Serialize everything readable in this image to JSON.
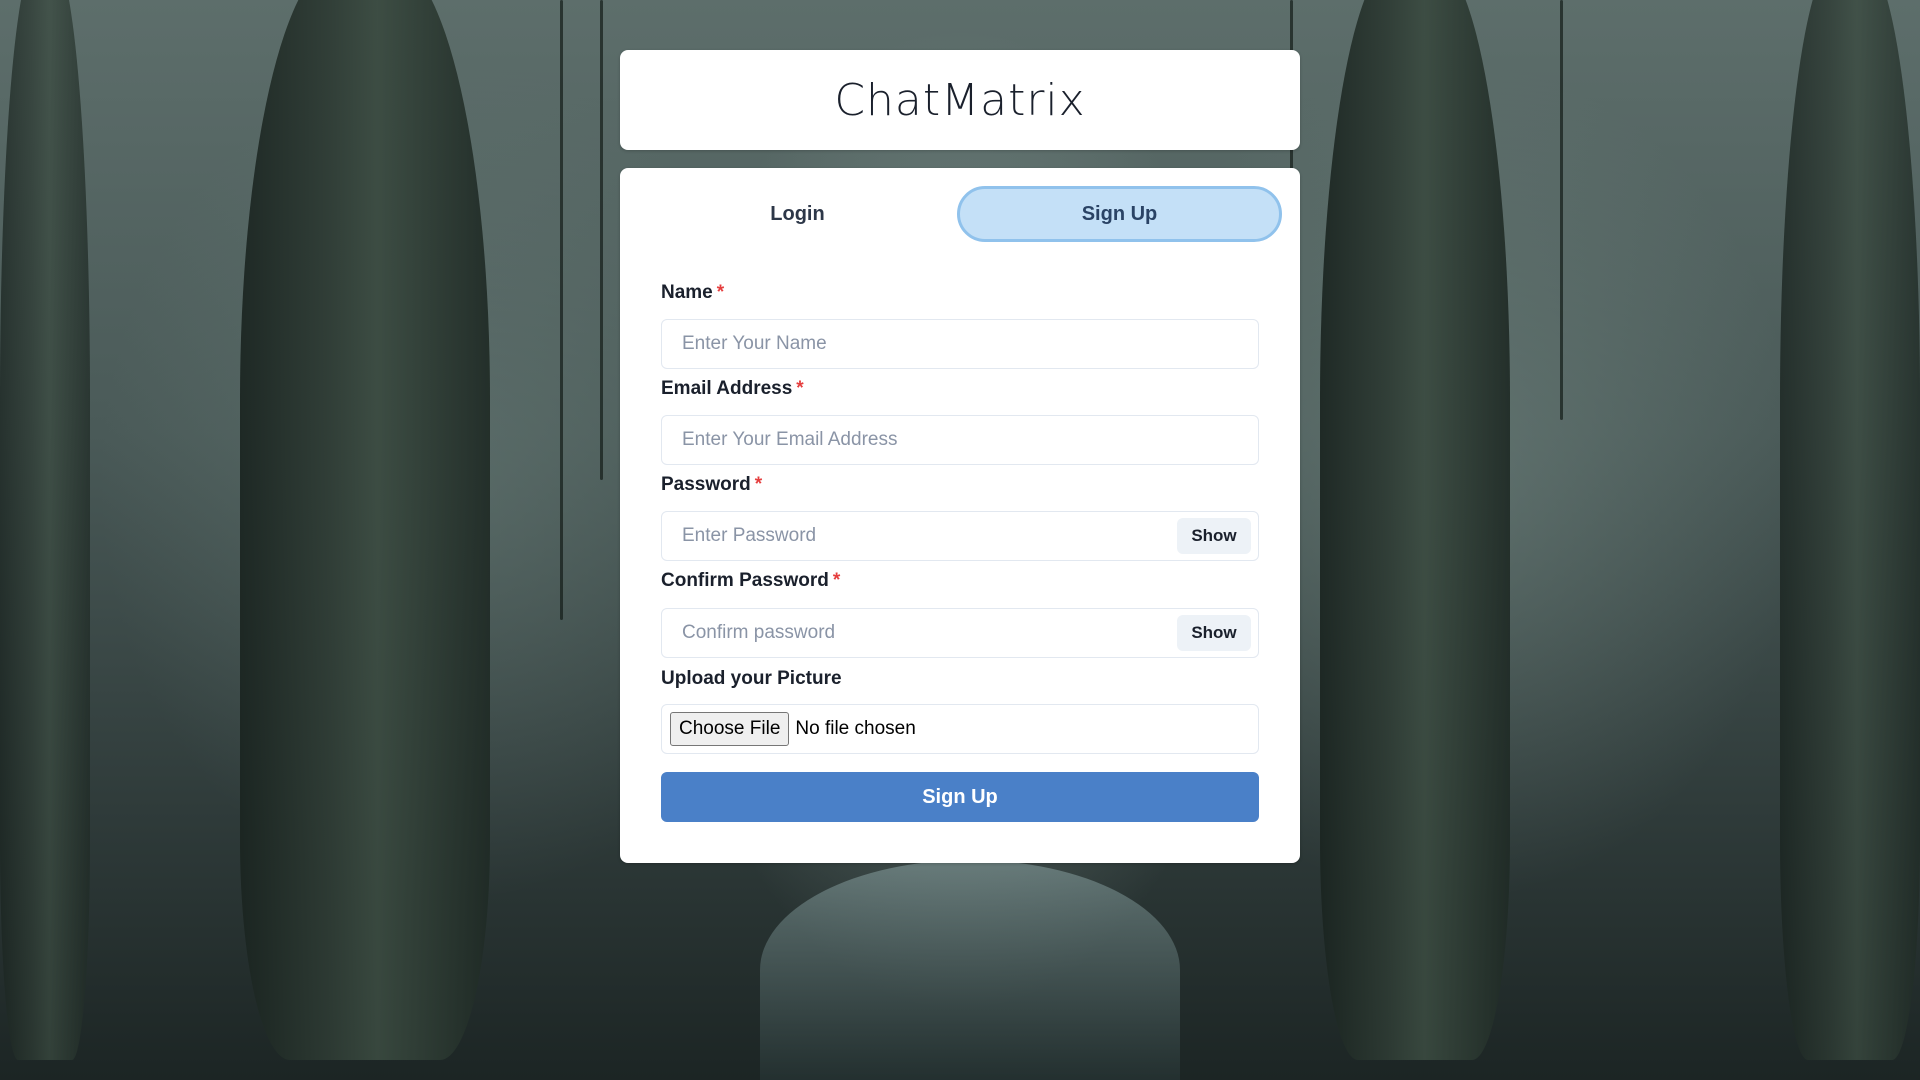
{
  "app": {
    "title": "ChatMatrix"
  },
  "tabs": [
    {
      "label": "Login",
      "active": false
    },
    {
      "label": "Sign Up",
      "active": true
    }
  ],
  "form": {
    "name": {
      "label": "Name",
      "required_mark": "*",
      "placeholder": "Enter Your Name",
      "value": ""
    },
    "email": {
      "label": "Email Address",
      "required_mark": "*",
      "placeholder": "Enter Your Email Address",
      "value": ""
    },
    "password": {
      "label": "Password",
      "required_mark": "*",
      "placeholder": "Enter Password",
      "value": "",
      "toggle_label": "Show"
    },
    "confirm_password": {
      "label": "Confirm Password",
      "required_mark": "*",
      "placeholder": "Confirm password",
      "value": "",
      "toggle_label": "Show"
    },
    "picture": {
      "label": "Upload your Picture",
      "button_label": "Choose File",
      "status_text": "No file chosen"
    },
    "submit_label": "Sign Up"
  },
  "colors": {
    "active_tab_bg": "#c4e0f7",
    "active_tab_border": "#90c2ec",
    "submit_bg": "#4a80c8",
    "required": "#e53e3e"
  }
}
